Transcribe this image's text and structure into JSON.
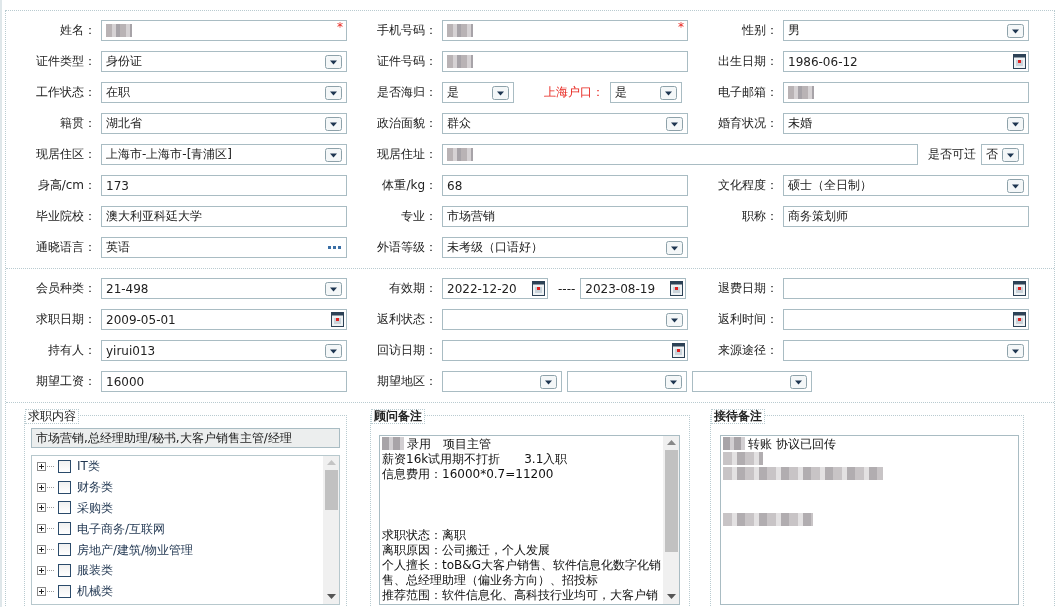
{
  "profile": {
    "rows": [
      {
        "cells": [
          {
            "kind": "single",
            "items": [
              {
                "label": "姓名：",
                "kind": "text",
                "blurred": true,
                "required_mark": "*"
              }
            ]
          },
          {
            "kind": "single",
            "items": [
              {
                "label": "手机号码：",
                "kind": "text",
                "blurred": true,
                "required_mark": "*"
              }
            ]
          },
          {
            "kind": "single",
            "items": [
              {
                "label": "性别：",
                "kind": "select",
                "value": "男"
              }
            ]
          }
        ]
      },
      {
        "cells": [
          {
            "kind": "single",
            "items": [
              {
                "label": "证件类型：",
                "kind": "select",
                "value": "身份证"
              }
            ]
          },
          {
            "kind": "single",
            "items": [
              {
                "label": "证件号码：",
                "kind": "text",
                "blurred": true
              }
            ]
          },
          {
            "kind": "single",
            "items": [
              {
                "label": "出生日期：",
                "kind": "date",
                "value": "1986-06-12"
              }
            ]
          }
        ]
      },
      {
        "cells": [
          {
            "kind": "single",
            "items": [
              {
                "label": "工作状态：",
                "kind": "select",
                "value": "在职"
              }
            ]
          },
          {
            "kind": "pair_short",
            "items": [
              {
                "label": "是否海归：",
                "kind": "select",
                "value": "是"
              },
              {
                "label": "上海户口：",
                "kind": "select",
                "value": "是"
              }
            ]
          },
          {
            "kind": "single",
            "items": [
              {
                "label": "电子邮箱：",
                "kind": "text",
                "blurred": true
              }
            ]
          }
        ]
      },
      {
        "cells": [
          {
            "kind": "single",
            "items": [
              {
                "label": "籍贯：",
                "kind": "select",
                "value": "湖北省"
              }
            ]
          },
          {
            "kind": "single",
            "items": [
              {
                "label": "政治面貌：",
                "kind": "select",
                "value": "群众"
              }
            ]
          },
          {
            "kind": "single",
            "items": [
              {
                "label": "婚育状况：",
                "kind": "select",
                "value": "未婚"
              }
            ]
          }
        ]
      },
      {
        "cells": [
          {
            "kind": "single",
            "items": [
              {
                "label": "现居住区：",
                "kind": "select",
                "value": "上海市-上海市-[青浦区]"
              }
            ]
          },
          {
            "kind": "address",
            "items": [
              {
                "label": "现居住址：",
                "kind": "text",
                "blurred": true
              },
              {
                "label": "是否可迁",
                "kind": "select",
                "value": "否"
              }
            ]
          }
        ]
      },
      {
        "cells": [
          {
            "kind": "single",
            "items": [
              {
                "label": "身高/cm：",
                "kind": "text",
                "value": "173"
              }
            ]
          },
          {
            "kind": "single",
            "items": [
              {
                "label": "体重/kg：",
                "kind": "text",
                "value": "68"
              }
            ]
          },
          {
            "kind": "single",
            "items": [
              {
                "label": "文化程度：",
                "kind": "select",
                "value": "硕士（全日制）"
              }
            ]
          }
        ]
      },
      {
        "cells": [
          {
            "kind": "single",
            "items": [
              {
                "label": "毕业院校：",
                "kind": "text",
                "value": "澳大利亚科廷大学"
              }
            ]
          },
          {
            "kind": "single",
            "items": [
              {
                "label": "专业：",
                "kind": "text",
                "value": "市场营销"
              }
            ]
          },
          {
            "kind": "single",
            "items": [
              {
                "label": "职称：",
                "kind": "text",
                "value": "商务策划师"
              }
            ]
          }
        ]
      },
      {
        "cells": [
          {
            "kind": "single",
            "items": [
              {
                "label": "通晓语言：",
                "kind": "lookup",
                "value": "英语"
              }
            ]
          },
          {
            "kind": "single",
            "items": [
              {
                "label": "外语等级：",
                "kind": "select",
                "value": "未考级（口语好）"
              }
            ]
          }
        ]
      }
    ]
  },
  "membership": {
    "rows": [
      {
        "cells": [
          {
            "kind": "single",
            "items": [
              {
                "label": "会员种类：",
                "kind": "select",
                "value": "21-498"
              }
            ]
          },
          {
            "kind": "date_range",
            "separator": "----",
            "items": [
              {
                "label": "有效期：",
                "kind": "date",
                "value": "2022-12-20"
              },
              {
                "kind": "date",
                "value": "2023-08-19"
              }
            ]
          },
          {
            "kind": "single",
            "items": [
              {
                "label": "退费日期：",
                "kind": "date"
              }
            ]
          }
        ]
      },
      {
        "cells": [
          {
            "kind": "single",
            "items": [
              {
                "label": "求职日期：",
                "kind": "date",
                "value": "2009-05-01"
              }
            ]
          },
          {
            "kind": "single",
            "items": [
              {
                "label": "返利状态：",
                "kind": "select"
              }
            ]
          },
          {
            "kind": "single",
            "items": [
              {
                "label": "返利时间：",
                "kind": "date"
              }
            ]
          }
        ]
      },
      {
        "cells": [
          {
            "kind": "single",
            "items": [
              {
                "label": "持有人：",
                "kind": "select",
                "value": "yirui013"
              }
            ]
          },
          {
            "kind": "single",
            "items": [
              {
                "label": "回访日期：",
                "kind": "date"
              }
            ]
          },
          {
            "kind": "single",
            "items": [
              {
                "label": "来源途径：",
                "kind": "select"
              }
            ]
          }
        ]
      },
      {
        "cells": [
          {
            "kind": "single",
            "items": [
              {
                "label": "期望工资：",
                "kind": "text",
                "value": "16000"
              }
            ]
          },
          {
            "kind": "triple",
            "items": [
              {
                "label": "期望地区：",
                "kind": "select"
              },
              {
                "kind": "select"
              },
              {
                "kind": "select"
              }
            ]
          }
        ]
      }
    ]
  },
  "job_intent": {
    "legend": "求职内容",
    "bold": false,
    "summary": "市场营销,总经理助理/秘书,大客户销售主管/经理",
    "tree": [
      {
        "label": "IT类",
        "checked": false,
        "expanded": false
      },
      {
        "label": "财务类",
        "checked": false,
        "expanded": false
      },
      {
        "label": "采购类",
        "checked": false,
        "expanded": false
      },
      {
        "label": "电子商务/互联网",
        "checked": false,
        "expanded": false
      },
      {
        "label": "房地产/建筑/物业管理",
        "checked": false,
        "expanded": false
      },
      {
        "label": "服装类",
        "checked": false,
        "expanded": false
      },
      {
        "label": "机械类",
        "checked": false,
        "expanded": false
      }
    ]
  },
  "notes": [
    {
      "legend": "顾问备注",
      "bold": true,
      "scrollbar": true,
      "lines": [
        {
          "kind": "text",
          "text": "录用　项目主管",
          "blur_before": true
        },
        {
          "kind": "text",
          "text": "薪资16k试用期不打折　　3.1入职",
          "blur_before": false
        },
        {
          "kind": "text",
          "text": "信息费用：16000*0.7=11200",
          "blur_before": false
        },
        {
          "kind": "blank"
        },
        {
          "kind": "blank"
        },
        {
          "kind": "blank"
        },
        {
          "kind": "text",
          "text": "求职状态：离职",
          "blur_before": false
        },
        {
          "kind": "text",
          "text": "离职原因：公司搬迁，个人发展",
          "blur_before": false
        },
        {
          "kind": "text",
          "text": "个人擅长：toB&G大客户销售、软件信息化数字化销",
          "blur_before": false
        },
        {
          "kind": "text",
          "text": "售、总经理助理（偏业务方向）、招投标",
          "blur_before": false
        },
        {
          "kind": "text",
          "text": "推荐范围：软件信息化、高科技行业均可，大客户销",
          "blur_before": false
        }
      ]
    },
    {
      "legend": "接待备注",
      "bold": true,
      "scrollbar": false,
      "lines": [
        {
          "kind": "text",
          "text": "转账  协议已回传",
          "blur_before": true
        },
        {
          "kind": "blurred"
        },
        {
          "kind": "blurred"
        },
        {
          "kind": "blank"
        },
        {
          "kind": "blank"
        },
        {
          "kind": "blurred"
        }
      ]
    }
  ]
}
